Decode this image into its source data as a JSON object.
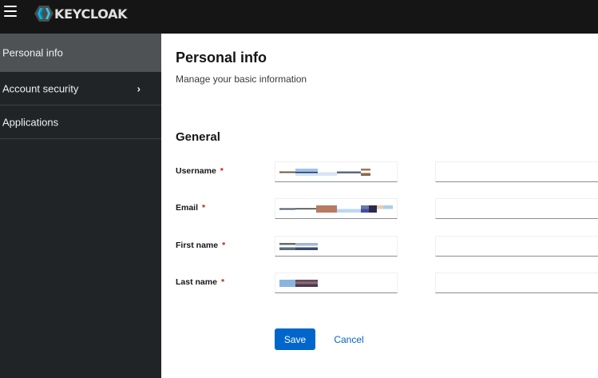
{
  "header": {
    "brand": "KEYCLOAK",
    "menu_icon": "hamburger-menu-icon",
    "logo_icon": "keycloak-hexagon-icon"
  },
  "sidebar": {
    "items": [
      {
        "label": "Personal info",
        "active": true
      },
      {
        "label": "Account security",
        "has_submenu": true,
        "chevron": "›"
      },
      {
        "label": "Applications"
      }
    ]
  },
  "main": {
    "title": "Personal info",
    "subtitle": "Manage your basic information",
    "section_title": "General",
    "fields": [
      {
        "label": "Username",
        "required_mark": "*"
      },
      {
        "label": "Email",
        "required_mark": "*"
      },
      {
        "label": "First name",
        "required_mark": "*"
      },
      {
        "label": "Last name",
        "required_mark": "*"
      }
    ],
    "save_label": "Save",
    "cancel_label": "Cancel"
  },
  "colors": {
    "masthead": "#151515",
    "sidebar": "#212427",
    "sidebar_active": "#4f5255",
    "primary": "#0066cc",
    "required": "#c9190b"
  }
}
